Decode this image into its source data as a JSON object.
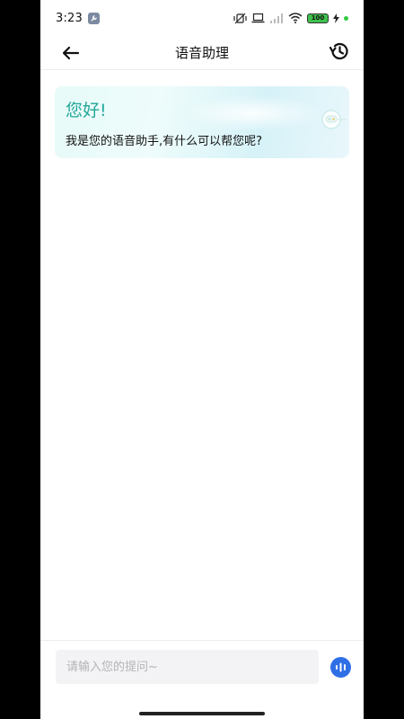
{
  "status_bar": {
    "time": "3:23",
    "battery": "100"
  },
  "header": {
    "title": "语音助理"
  },
  "greeting": {
    "title": "您好!",
    "subtitle": "我是您的语音助手,有什么可以帮您呢?"
  },
  "input": {
    "placeholder": "请输入您的提问~"
  },
  "colors": {
    "accent_teal": "#23a79a",
    "voice_button": "#2f6fe6",
    "battery_green": "#3ec14d"
  },
  "icons": {
    "back": "arrow-left-icon",
    "history": "history-clock-icon",
    "robot": "robot-icon",
    "voice": "voice-wave-icon"
  }
}
